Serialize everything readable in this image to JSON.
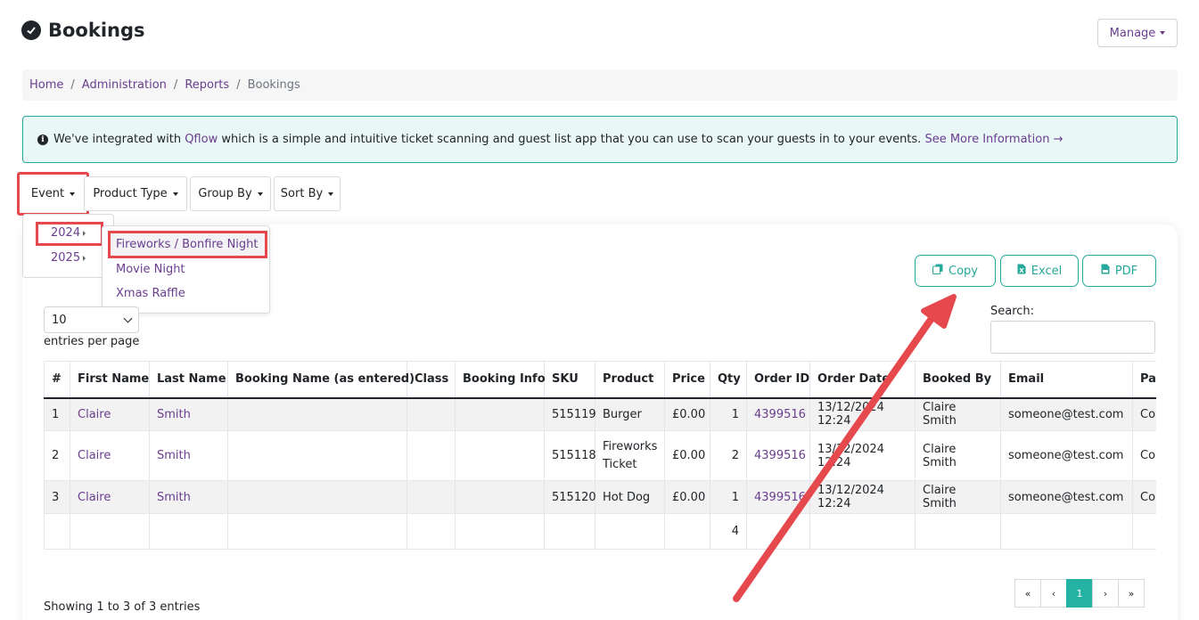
{
  "page": {
    "title": "Bookings",
    "manage_label": "Manage"
  },
  "breadcrumb": [
    {
      "label": "Home"
    },
    {
      "label": "Administration"
    },
    {
      "label": "Reports"
    },
    {
      "label": "Bookings"
    }
  ],
  "alert": {
    "prefix": "We've integrated with",
    "qflow_link": "Qflow",
    "text": "which is a simple and intuitive ticket scanning and guest list app that you can use to scan your guests in to your events.",
    "more_link": "See More Information →"
  },
  "filters": {
    "event": "Event",
    "product_type": "Product Type",
    "group_by": "Group By",
    "sort_by": "Sort By"
  },
  "event_menu": {
    "years": [
      "2024",
      "2025"
    ],
    "events_2024": [
      "Fireworks / Bonfire Night",
      "Movie Night",
      "Xmas Raffle"
    ]
  },
  "export": {
    "copy": "Copy",
    "excel": "Excel",
    "pdf": "PDF"
  },
  "entries": {
    "value": "10",
    "label": "entries per page"
  },
  "search": {
    "label": "Search:",
    "value": ""
  },
  "table": {
    "columns": [
      "#",
      "First Name",
      "Last Name",
      "Booking Name (as entered)",
      "Class",
      "Booking Info",
      "SKU",
      "Product",
      "Price",
      "Qty",
      "Order ID",
      "Order Date",
      "Booked By",
      "Email",
      "Pa"
    ],
    "rows": [
      {
        "n": "1",
        "first": "Claire",
        "last": "Smith",
        "booking_name": "",
        "class": "",
        "info": "",
        "sku": "515119",
        "product": "Burger",
        "price": "£0.00",
        "qty": "1",
        "order_id": "4399516",
        "order_date": "13/12/2024 12:24",
        "booked_by": "Claire Smith",
        "email": "someone@test.com",
        "pay": "Co"
      },
      {
        "n": "2",
        "first": "Claire",
        "last": "Smith",
        "booking_name": "",
        "class": "",
        "info": "",
        "sku": "515118",
        "product": "Fireworks Ticket",
        "price": "£0.00",
        "qty": "2",
        "order_id": "4399516",
        "order_date": "13/12/2024 12:24",
        "booked_by": "Claire Smith",
        "email": "someone@test.com",
        "pay": "Co"
      },
      {
        "n": "3",
        "first": "Claire",
        "last": "Smith",
        "booking_name": "",
        "class": "",
        "info": "",
        "sku": "515120",
        "product": "Hot Dog",
        "price": "£0.00",
        "qty": "1",
        "order_id": "4399516",
        "order_date": "13/12/2024 12:24",
        "booked_by": "Claire Smith",
        "email": "someone@test.com",
        "pay": "Co"
      }
    ],
    "total_qty": "4"
  },
  "pagination": {
    "first": "«",
    "prev": "‹",
    "current": "1",
    "next": "›",
    "last": "»"
  },
  "footer": {
    "showing": "Showing 1 to 3 of 3 entries"
  },
  "colors": {
    "accent": "#6a3d8f",
    "teal": "#24a99b",
    "highlight": "#e5484d"
  }
}
